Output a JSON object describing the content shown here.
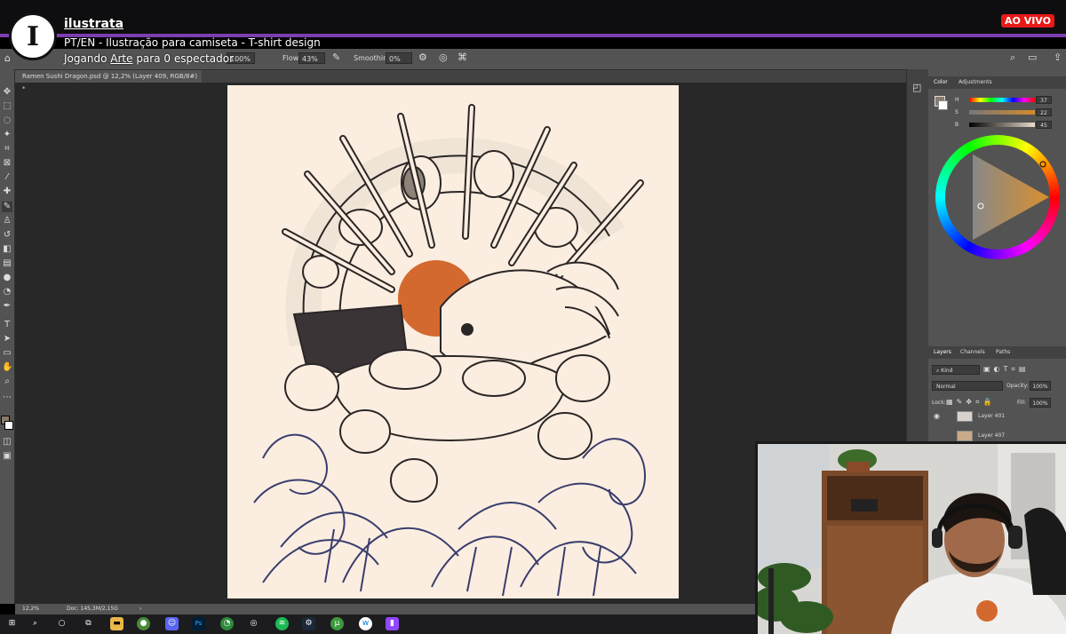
{
  "stream": {
    "channel_name": "ilustrata",
    "logo_letter": "I",
    "title": "PT/EN - Ilustração para camiseta - T-shirt design",
    "sub_prefix": "Jogando",
    "sub_category": "Arte",
    "sub_suffix": "para 0 espectador",
    "live_label": "AO VIVO"
  },
  "photoshop": {
    "options": {
      "zoom": "100%",
      "flow_label": "Flow:",
      "flow_value": "43%",
      "smoothing_label": "Smoothing:",
      "smoothing_value": "0%"
    },
    "document_tab": "Ramen Sushi Dragon.psd @ 12,2% (Layer 409, RGB/8#) *",
    "status": {
      "zoom": "12,2%",
      "doc": "Doc: 145,3M/2,15G",
      "arrow": "›"
    },
    "color_panel": {
      "tabs": [
        "Color",
        "Adjustments"
      ],
      "sliders": [
        {
          "label": "H",
          "value": "37"
        },
        {
          "label": "S",
          "value": "22"
        },
        {
          "label": "B",
          "value": "45"
        }
      ]
    },
    "layers_panel": {
      "tabs": [
        "Layers",
        "Channels",
        "Paths"
      ],
      "filter": "Kind",
      "blend_mode": "Normal",
      "opacity_label": "Opacity:",
      "opacity_value": "100%",
      "lock_label": "Lock:",
      "fill_label": "Fill:",
      "fill_value": "100%",
      "layers": [
        {
          "name": "Layer 401"
        },
        {
          "name": "Layer 407"
        }
      ]
    }
  },
  "colors": {
    "accent_purple": "#7b3fb0",
    "live_red": "#e91916",
    "canvas_cream": "#fbeee0",
    "sun_orange": "#d4692f",
    "ink_navy": "#3a3d6e"
  }
}
